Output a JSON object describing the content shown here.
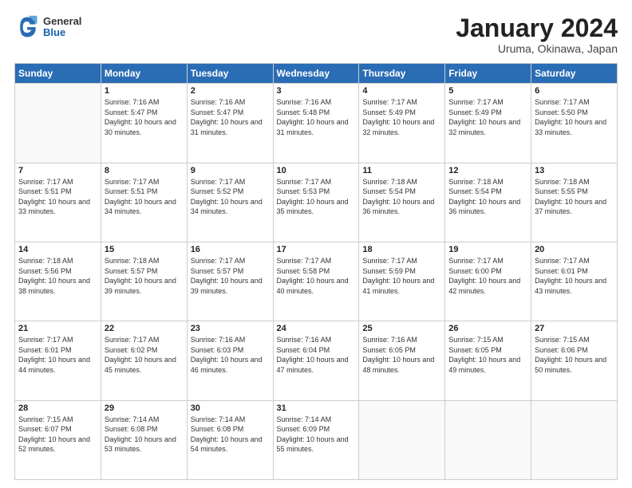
{
  "logo": {
    "general": "General",
    "blue": "Blue"
  },
  "header": {
    "month": "January 2024",
    "location": "Uruma, Okinawa, Japan"
  },
  "weekdays": [
    "Sunday",
    "Monday",
    "Tuesday",
    "Wednesday",
    "Thursday",
    "Friday",
    "Saturday"
  ],
  "weeks": [
    [
      {
        "day": "",
        "sunrise": "",
        "sunset": "",
        "daylight": ""
      },
      {
        "day": "1",
        "sunrise": "Sunrise: 7:16 AM",
        "sunset": "Sunset: 5:47 PM",
        "daylight": "Daylight: 10 hours and 30 minutes."
      },
      {
        "day": "2",
        "sunrise": "Sunrise: 7:16 AM",
        "sunset": "Sunset: 5:47 PM",
        "daylight": "Daylight: 10 hours and 31 minutes."
      },
      {
        "day": "3",
        "sunrise": "Sunrise: 7:16 AM",
        "sunset": "Sunset: 5:48 PM",
        "daylight": "Daylight: 10 hours and 31 minutes."
      },
      {
        "day": "4",
        "sunrise": "Sunrise: 7:17 AM",
        "sunset": "Sunset: 5:49 PM",
        "daylight": "Daylight: 10 hours and 32 minutes."
      },
      {
        "day": "5",
        "sunrise": "Sunrise: 7:17 AM",
        "sunset": "Sunset: 5:49 PM",
        "daylight": "Daylight: 10 hours and 32 minutes."
      },
      {
        "day": "6",
        "sunrise": "Sunrise: 7:17 AM",
        "sunset": "Sunset: 5:50 PM",
        "daylight": "Daylight: 10 hours and 33 minutes."
      }
    ],
    [
      {
        "day": "7",
        "sunrise": "Sunrise: 7:17 AM",
        "sunset": "Sunset: 5:51 PM",
        "daylight": "Daylight: 10 hours and 33 minutes."
      },
      {
        "day": "8",
        "sunrise": "Sunrise: 7:17 AM",
        "sunset": "Sunset: 5:51 PM",
        "daylight": "Daylight: 10 hours and 34 minutes."
      },
      {
        "day": "9",
        "sunrise": "Sunrise: 7:17 AM",
        "sunset": "Sunset: 5:52 PM",
        "daylight": "Daylight: 10 hours and 34 minutes."
      },
      {
        "day": "10",
        "sunrise": "Sunrise: 7:17 AM",
        "sunset": "Sunset: 5:53 PM",
        "daylight": "Daylight: 10 hours and 35 minutes."
      },
      {
        "day": "11",
        "sunrise": "Sunrise: 7:18 AM",
        "sunset": "Sunset: 5:54 PM",
        "daylight": "Daylight: 10 hours and 36 minutes."
      },
      {
        "day": "12",
        "sunrise": "Sunrise: 7:18 AM",
        "sunset": "Sunset: 5:54 PM",
        "daylight": "Daylight: 10 hours and 36 minutes."
      },
      {
        "day": "13",
        "sunrise": "Sunrise: 7:18 AM",
        "sunset": "Sunset: 5:55 PM",
        "daylight": "Daylight: 10 hours and 37 minutes."
      }
    ],
    [
      {
        "day": "14",
        "sunrise": "Sunrise: 7:18 AM",
        "sunset": "Sunset: 5:56 PM",
        "daylight": "Daylight: 10 hours and 38 minutes."
      },
      {
        "day": "15",
        "sunrise": "Sunrise: 7:18 AM",
        "sunset": "Sunset: 5:57 PM",
        "daylight": "Daylight: 10 hours and 39 minutes."
      },
      {
        "day": "16",
        "sunrise": "Sunrise: 7:17 AM",
        "sunset": "Sunset: 5:57 PM",
        "daylight": "Daylight: 10 hours and 39 minutes."
      },
      {
        "day": "17",
        "sunrise": "Sunrise: 7:17 AM",
        "sunset": "Sunset: 5:58 PM",
        "daylight": "Daylight: 10 hours and 40 minutes."
      },
      {
        "day": "18",
        "sunrise": "Sunrise: 7:17 AM",
        "sunset": "Sunset: 5:59 PM",
        "daylight": "Daylight: 10 hours and 41 minutes."
      },
      {
        "day": "19",
        "sunrise": "Sunrise: 7:17 AM",
        "sunset": "Sunset: 6:00 PM",
        "daylight": "Daylight: 10 hours and 42 minutes."
      },
      {
        "day": "20",
        "sunrise": "Sunrise: 7:17 AM",
        "sunset": "Sunset: 6:01 PM",
        "daylight": "Daylight: 10 hours and 43 minutes."
      }
    ],
    [
      {
        "day": "21",
        "sunrise": "Sunrise: 7:17 AM",
        "sunset": "Sunset: 6:01 PM",
        "daylight": "Daylight: 10 hours and 44 minutes."
      },
      {
        "day": "22",
        "sunrise": "Sunrise: 7:17 AM",
        "sunset": "Sunset: 6:02 PM",
        "daylight": "Daylight: 10 hours and 45 minutes."
      },
      {
        "day": "23",
        "sunrise": "Sunrise: 7:16 AM",
        "sunset": "Sunset: 6:03 PM",
        "daylight": "Daylight: 10 hours and 46 minutes."
      },
      {
        "day": "24",
        "sunrise": "Sunrise: 7:16 AM",
        "sunset": "Sunset: 6:04 PM",
        "daylight": "Daylight: 10 hours and 47 minutes."
      },
      {
        "day": "25",
        "sunrise": "Sunrise: 7:16 AM",
        "sunset": "Sunset: 6:05 PM",
        "daylight": "Daylight: 10 hours and 48 minutes."
      },
      {
        "day": "26",
        "sunrise": "Sunrise: 7:15 AM",
        "sunset": "Sunset: 6:05 PM",
        "daylight": "Daylight: 10 hours and 49 minutes."
      },
      {
        "day": "27",
        "sunrise": "Sunrise: 7:15 AM",
        "sunset": "Sunset: 6:06 PM",
        "daylight": "Daylight: 10 hours and 50 minutes."
      }
    ],
    [
      {
        "day": "28",
        "sunrise": "Sunrise: 7:15 AM",
        "sunset": "Sunset: 6:07 PM",
        "daylight": "Daylight: 10 hours and 52 minutes."
      },
      {
        "day": "29",
        "sunrise": "Sunrise: 7:14 AM",
        "sunset": "Sunset: 6:08 PM",
        "daylight": "Daylight: 10 hours and 53 minutes."
      },
      {
        "day": "30",
        "sunrise": "Sunrise: 7:14 AM",
        "sunset": "Sunset: 6:08 PM",
        "daylight": "Daylight: 10 hours and 54 minutes."
      },
      {
        "day": "31",
        "sunrise": "Sunrise: 7:14 AM",
        "sunset": "Sunset: 6:09 PM",
        "daylight": "Daylight: 10 hours and 55 minutes."
      },
      {
        "day": "",
        "sunrise": "",
        "sunset": "",
        "daylight": ""
      },
      {
        "day": "",
        "sunrise": "",
        "sunset": "",
        "daylight": ""
      },
      {
        "day": "",
        "sunrise": "",
        "sunset": "",
        "daylight": ""
      }
    ]
  ]
}
